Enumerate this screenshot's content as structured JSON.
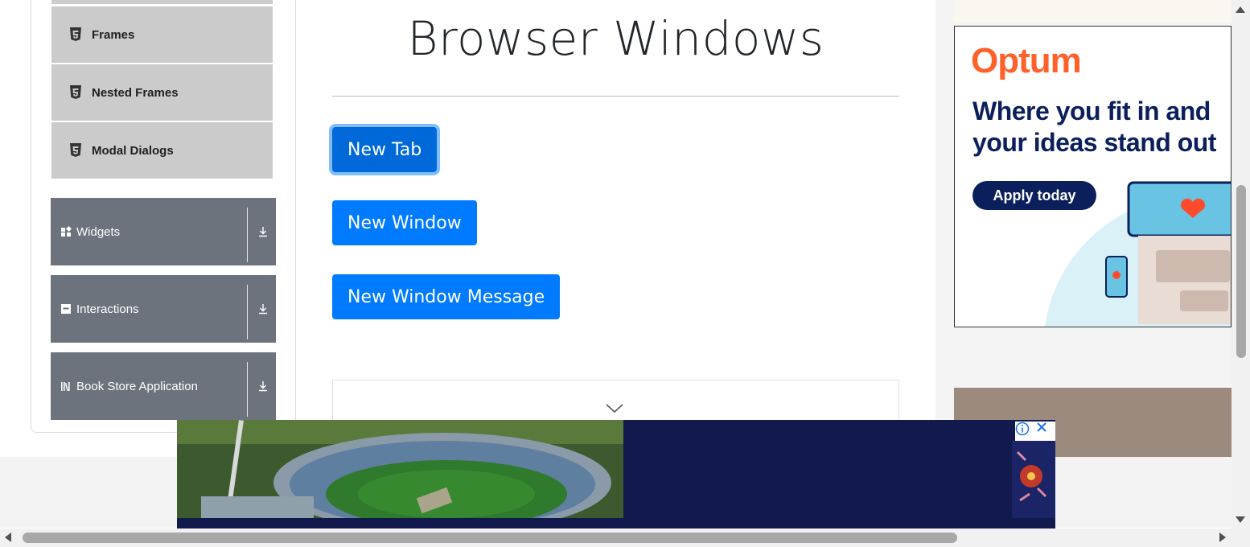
{
  "sidebar": {
    "sub_items": [
      {
        "label": "Frames",
        "icon": "html5-icon"
      },
      {
        "label": "Nested Frames",
        "icon": "html5-icon"
      },
      {
        "label": "Modal Dialogs",
        "icon": "html5-icon"
      }
    ],
    "groups": [
      {
        "label": "Widgets",
        "icon": "widgets-icon"
      },
      {
        "label": "Interactions",
        "icon": "interactions-icon"
      },
      {
        "label": "Book Store Application",
        "icon": "book-store-icon"
      }
    ]
  },
  "main": {
    "title": "Browser Windows",
    "buttons": {
      "new_tab": "New Tab",
      "new_window": "New Window",
      "new_window_message": "New Window Message"
    }
  },
  "ad_right": {
    "brand": "Optum",
    "headline": "Where you fit in and your ideas stand out",
    "cta": "Apply today",
    "brand_color": "#ff612b",
    "headline_color": "#0b1f5c"
  },
  "colors": {
    "primary_button": "#007bff",
    "sidebar_group": "#6c737d",
    "sidebar_sub": "#cbcbcb",
    "banner_bg": "#121a4d"
  }
}
